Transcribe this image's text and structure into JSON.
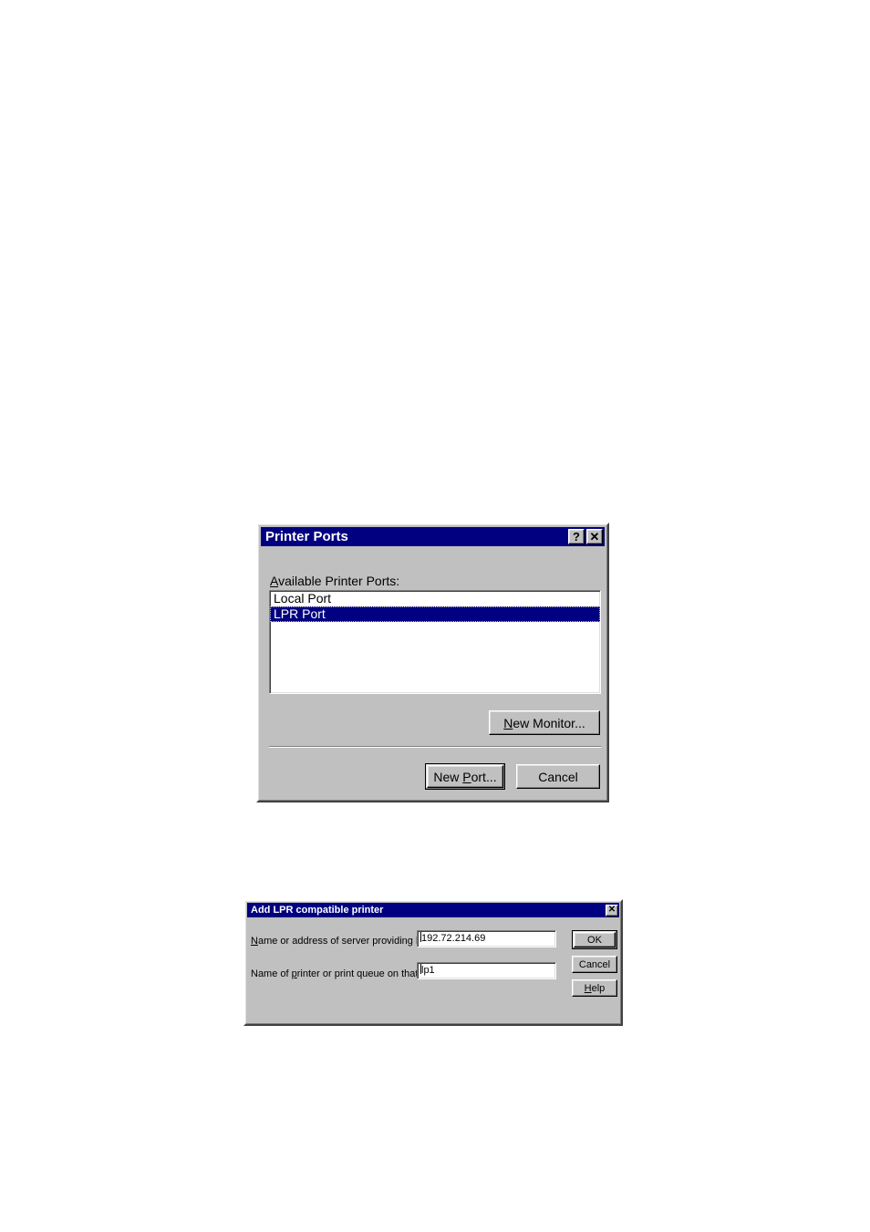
{
  "theme": {
    "titlebar_active": "#000080",
    "titlebar_text": "#FFFFFF",
    "dialog_face": "#C0C0C0",
    "field_background": "#FFFFFF",
    "selection_background": "#000080",
    "selection_text": "#FFFFFF",
    "text": "#000000",
    "page_background": "#FFFFFF"
  },
  "printer_ports_dialog": {
    "title": "Printer Ports",
    "titlebar_buttons": {
      "help": "?",
      "close": "✕"
    },
    "list_label": "Available Printer Ports:",
    "list_label_accelerator": "A",
    "ports": [
      {
        "name": "Local Port",
        "selected": false
      },
      {
        "name": "LPR Port",
        "selected": true
      }
    ],
    "selected_port": "LPR Port",
    "buttons": {
      "new_monitor": "New Monitor...",
      "new_monitor_accelerator": "N",
      "new_port": "New Port...",
      "new_port_accelerator": "P",
      "cancel": "Cancel"
    },
    "default_button": "New Port..."
  },
  "add_lpr_dialog": {
    "title": "Add LPR compatible printer",
    "titlebar_buttons": {
      "close": "✕"
    },
    "fields": [
      {
        "label": "Name or address of server providing lpd:",
        "label_accelerator": "N",
        "value": "192.72.214.69",
        "focused": true
      },
      {
        "label": "Name of printer or print queue on that server:",
        "label_accelerator": "p",
        "value": "lp1",
        "focused": false
      }
    ],
    "buttons": {
      "ok": "OK",
      "cancel": "Cancel",
      "help": "Help",
      "help_accelerator": "H"
    },
    "default_button": "OK"
  }
}
